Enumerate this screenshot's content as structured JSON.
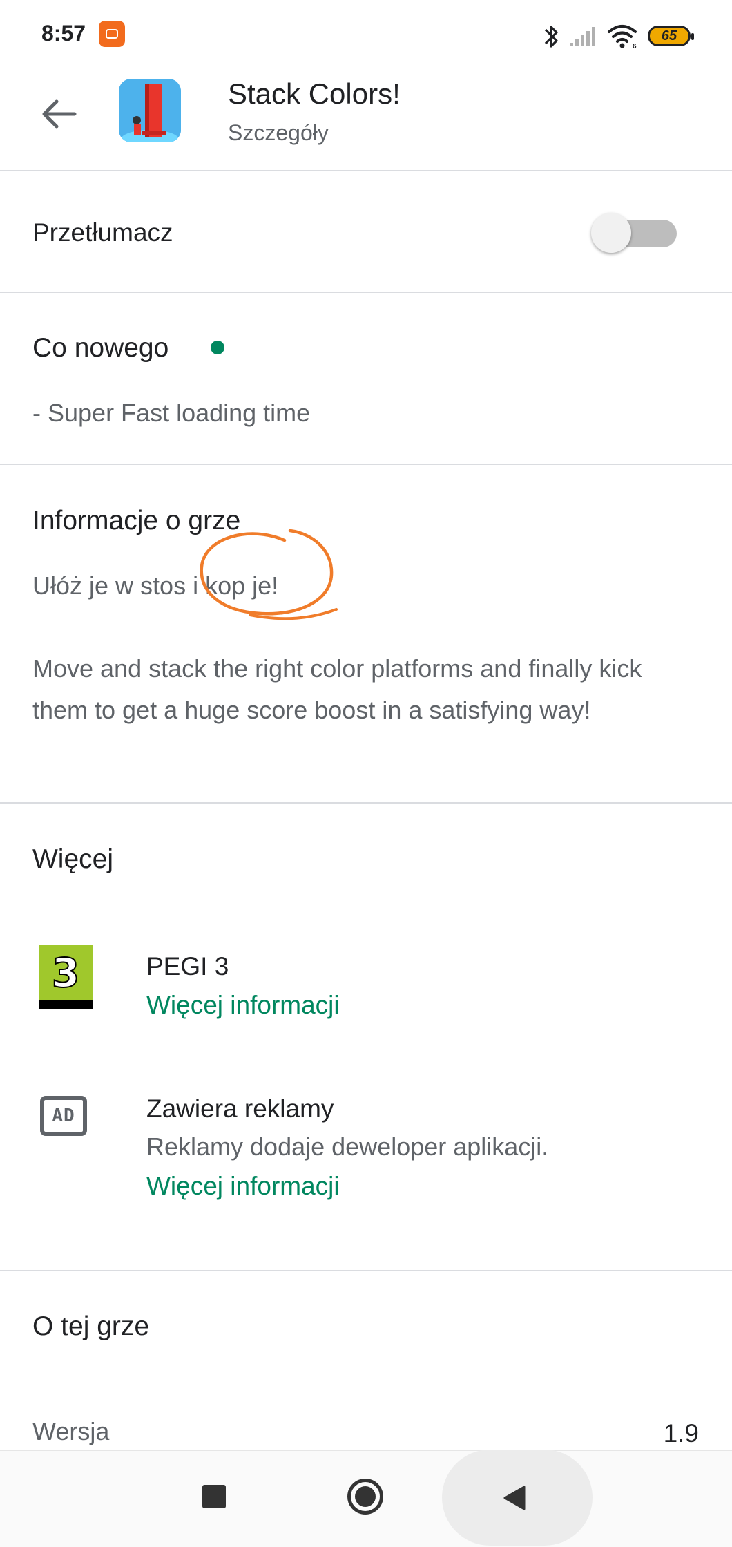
{
  "status_bar": {
    "time": "8:57",
    "notification_icon": "mi-app-icon",
    "icons": [
      "bluetooth-icon",
      "signal-icon",
      "wifi-icon"
    ],
    "battery": "65"
  },
  "header": {
    "title": "Stack Colors!",
    "subtitle": "Szczegóły"
  },
  "translator": {
    "label": "Przetłumacz",
    "enabled": false
  },
  "whats_new": {
    "title": "Co nowego",
    "indicator_color": "#01875f",
    "text": "- Super Fast loading time"
  },
  "game_info": {
    "title": "Informacje o grze",
    "tagline": "Ułóż je w stos i kop je!",
    "description": "Move and stack the right color platforms and finally kick them to get a huge score boost in a satisfying way!"
  },
  "more": {
    "title": "Więcej",
    "items": [
      {
        "icon": "pegi-3-icon",
        "icon_text": "3",
        "title": "PEGI 3",
        "link": "Więcej informacji"
      },
      {
        "icon": "ad-icon",
        "icon_text": "AD",
        "title": "Zawiera reklamy",
        "text": "Reklamy dodaje deweloper aplikacji.",
        "link": "Więcej informacji"
      }
    ]
  },
  "about": {
    "title": "O tej grze",
    "rows": [
      {
        "label": "Wersja",
        "value": "1.9"
      }
    ]
  },
  "colors": {
    "accent": "#01875f",
    "annotation": "#f07c2a",
    "primary_text": "#202124",
    "secondary_text": "#5f6368"
  }
}
